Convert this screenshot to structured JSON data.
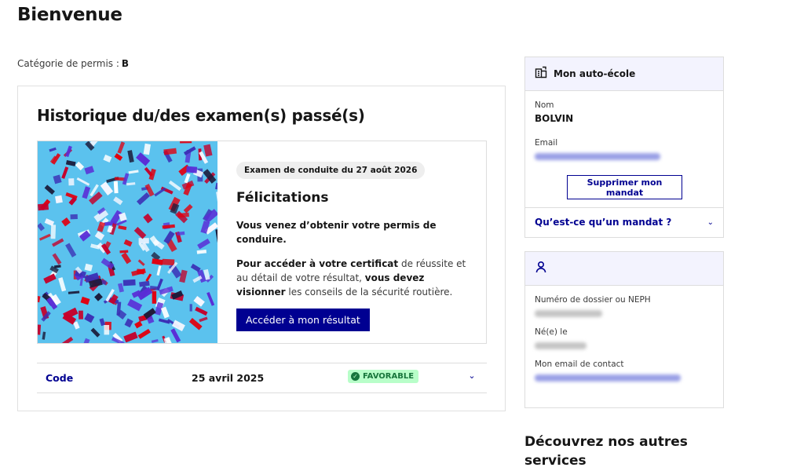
{
  "page": {
    "title": "Bienvenue",
    "category_label": "Catégorie de permis :",
    "category_value": "B"
  },
  "history": {
    "title": "Historique du/des examen(s) passé(s)",
    "result": {
      "badge": "Examen de conduite du 27 août 2026",
      "heading": "Félicitations",
      "text1": "Vous venez d’obtenir votre permis de conduire.",
      "text2_bold1": "Pour accéder à votre certificat",
      "text2_mid": " de réussite et au détail de votre résultat, ",
      "text2_bold2": "vous devez visionner",
      "text2_end": " les conseils de la sécurité routière.",
      "button": "Accéder à mon résultat"
    },
    "rows": [
      {
        "type": "Code",
        "date": "25 avril 2025",
        "status": "FAVORABLE"
      }
    ]
  },
  "school_panel": {
    "title": "Mon auto-école",
    "name_label": "Nom",
    "name_value": "BOLVIN",
    "email_label": "Email",
    "remove_button": "Supprimer mon mandat",
    "mandat_question": "Qu’est-ce qu’un mandat ?"
  },
  "user_panel": {
    "dossier_label": "Numéro de dossier ou NEPH",
    "birth_label": "Né(e) le",
    "email_label": "Mon email de contact"
  },
  "discover": {
    "title": "Découvrez nos autres services"
  },
  "colors": {
    "primary": "#000091",
    "panel_header": "#f3f3fe",
    "success_bg": "#b8fec9",
    "success_text": "#18753c",
    "confetti_bg": "#5bc2ee"
  }
}
